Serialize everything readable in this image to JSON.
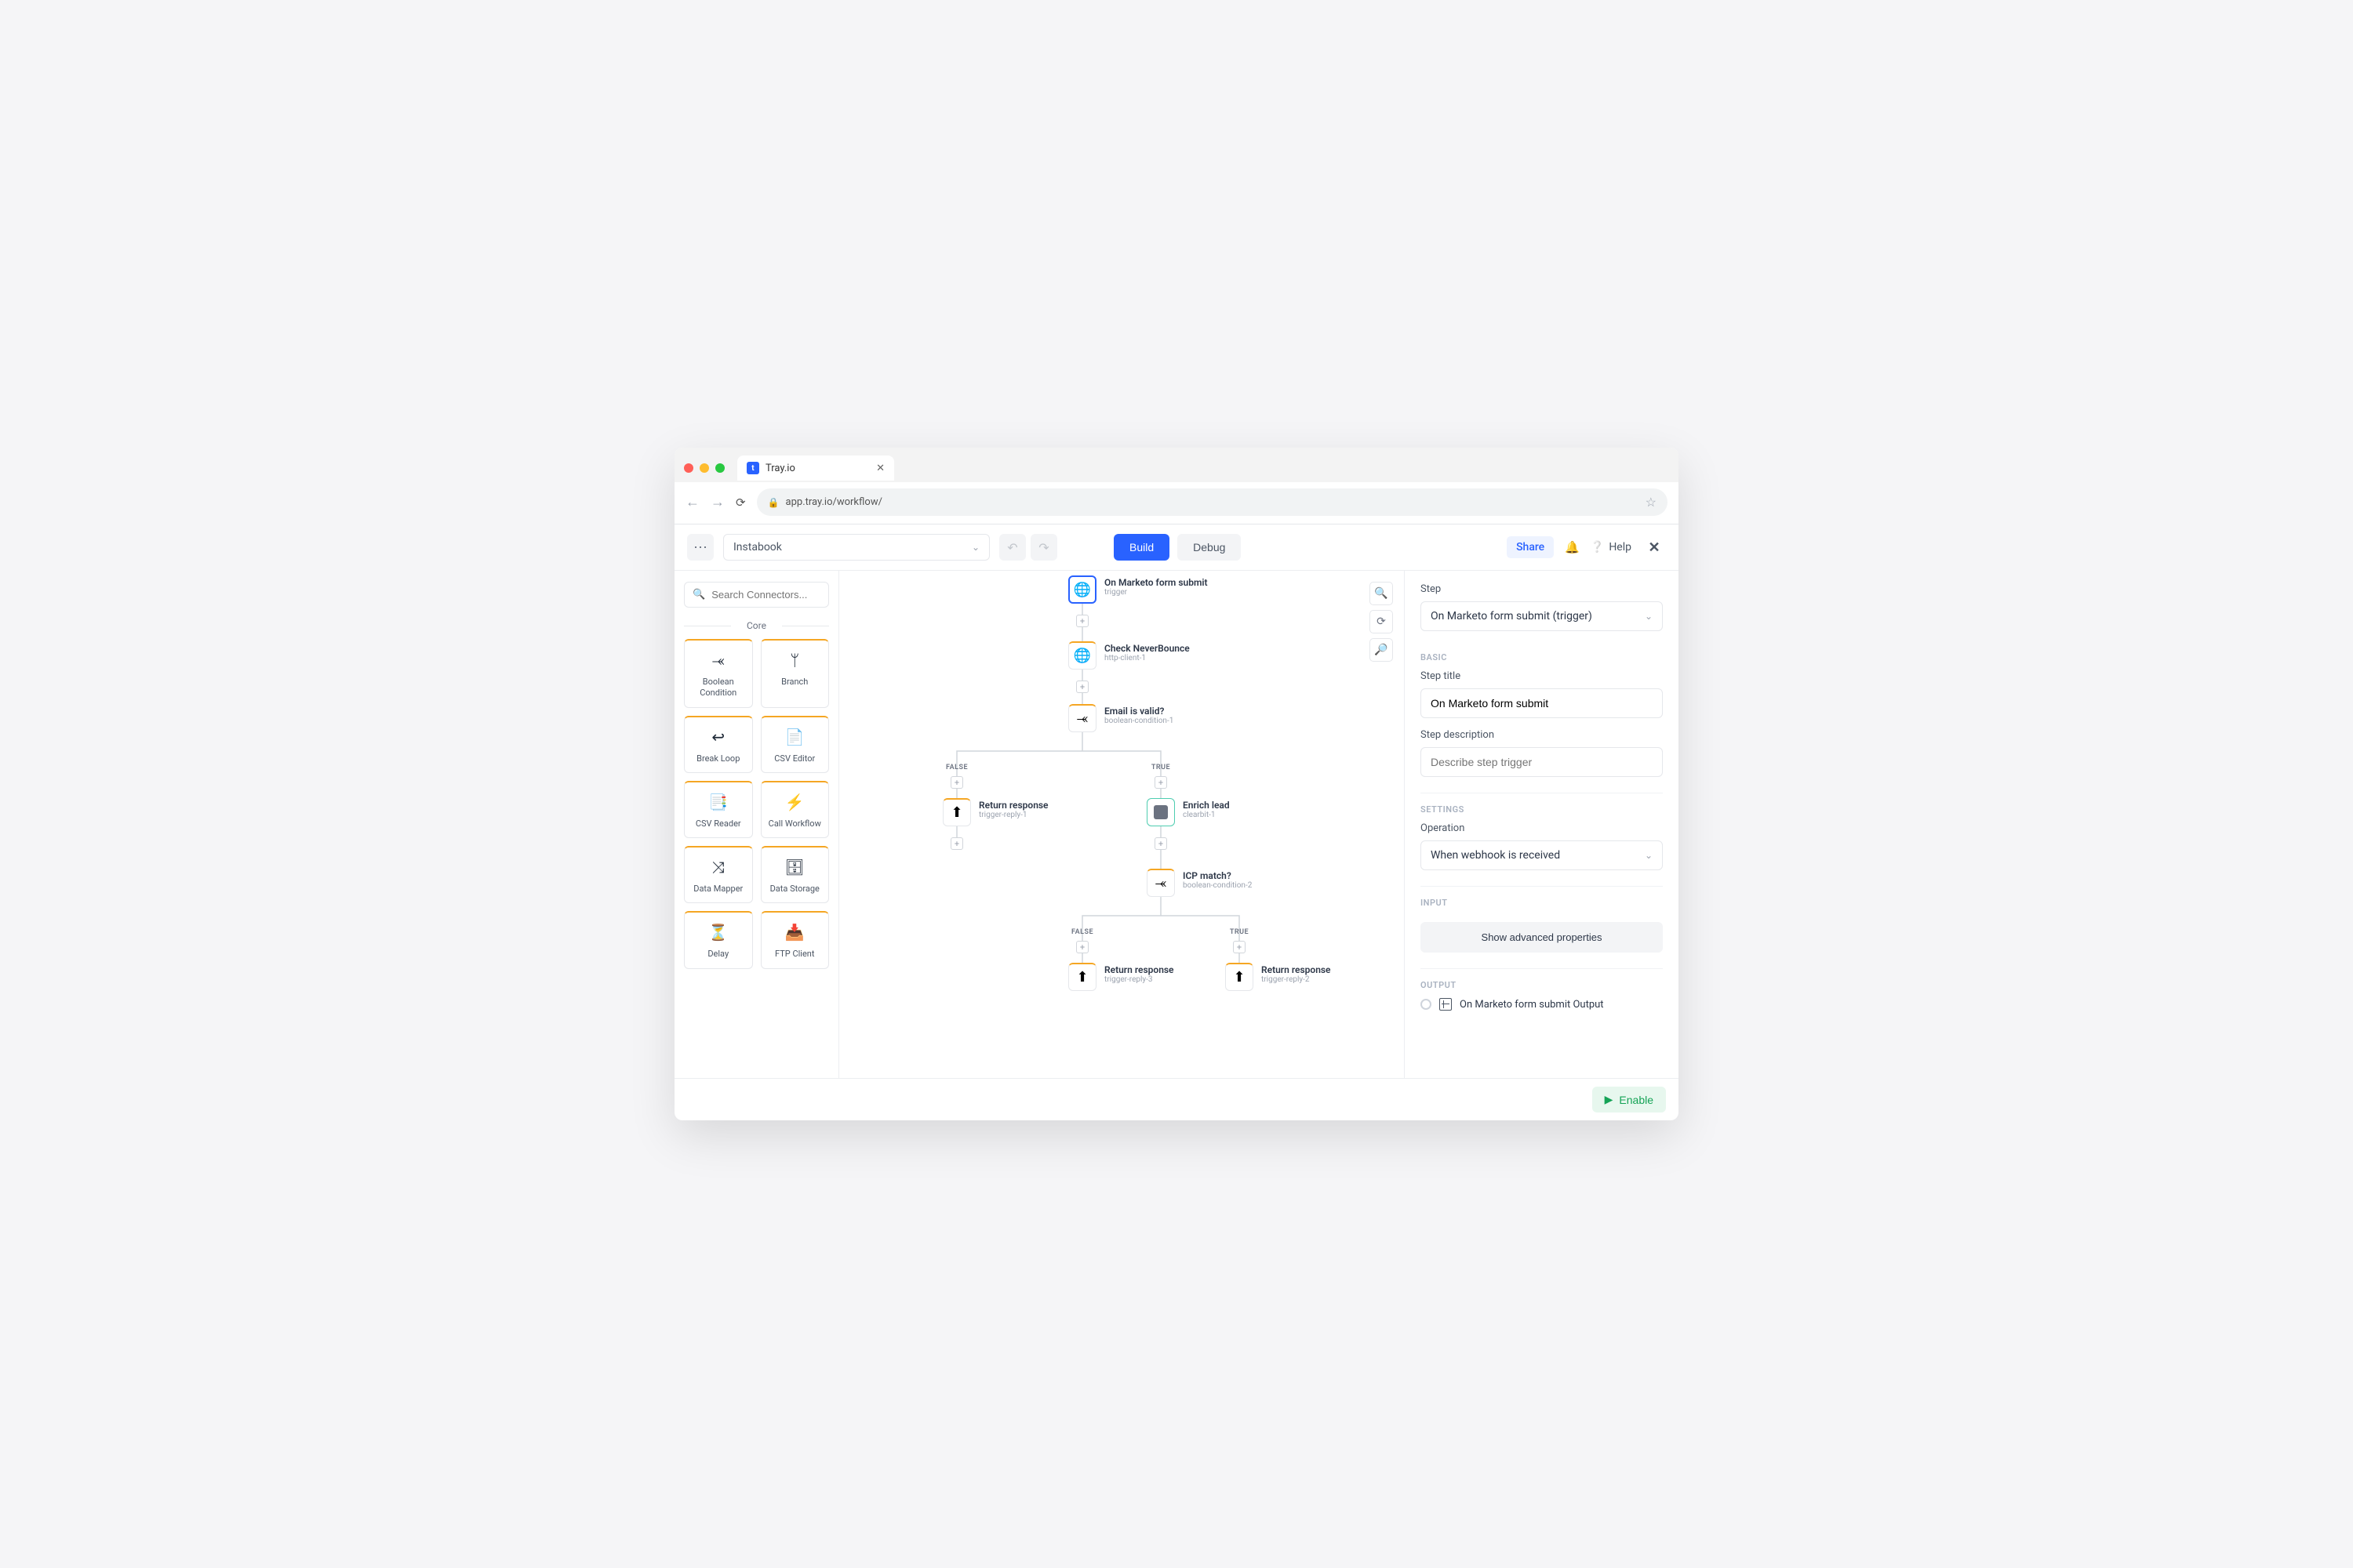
{
  "browser": {
    "tab_title": "Tray.io",
    "url": "app.tray.io/workflow/"
  },
  "topbar": {
    "workflow_name": "Instabook",
    "build_label": "Build",
    "debug_label": "Debug",
    "share_label": "Share",
    "help_label": "Help"
  },
  "sidebar": {
    "search_placeholder": "Search Connectors...",
    "section_label": "Core",
    "connectors": [
      {
        "label": "Boolean Condition",
        "icon": "boolean"
      },
      {
        "label": "Branch",
        "icon": "branch"
      },
      {
        "label": "Break Loop",
        "icon": "loop"
      },
      {
        "label": "CSV Editor",
        "icon": "csv-edit"
      },
      {
        "label": "CSV Reader",
        "icon": "csv-read"
      },
      {
        "label": "Call Workflow",
        "icon": "bolt"
      },
      {
        "label": "Data Mapper",
        "icon": "mapper"
      },
      {
        "label": "Data Storage",
        "icon": "storage"
      },
      {
        "label": "Delay",
        "icon": "delay"
      },
      {
        "label": "FTP Client",
        "icon": "ftp"
      }
    ]
  },
  "canvas": {
    "nodes": {
      "trigger": {
        "title": "On Marketo form submit",
        "sub": "trigger"
      },
      "check_nb": {
        "title": "Check NeverBounce",
        "sub": "http-client-1"
      },
      "email_valid": {
        "title": "Email is valid?",
        "sub": "boolean-condition-1"
      },
      "return_false": {
        "title": "Return response",
        "sub": "trigger-reply-1"
      },
      "enrich": {
        "title": "Enrich lead",
        "sub": "clearbit-1"
      },
      "icp": {
        "title": "ICP match?",
        "sub": "boolean-condition-2"
      },
      "return_icp_false": {
        "title": "Return response",
        "sub": "trigger-reply-3"
      },
      "return_icp_true": {
        "title": "Return response",
        "sub": "trigger-reply-2"
      }
    },
    "branch_labels": {
      "false": "FALSE",
      "true": "TRUE"
    }
  },
  "panel": {
    "step_label": "Step",
    "step_select": "On Marketo form submit (trigger)",
    "basic_header": "BASIC",
    "title_label": "Step title",
    "title_value": "On Marketo form submit",
    "desc_label": "Step description",
    "desc_placeholder": "Describe step trigger",
    "settings_header": "SETTINGS",
    "operation_label": "Operation",
    "operation_value": "When webhook is received",
    "input_header": "INPUT",
    "adv_label": "Show advanced properties",
    "output_header": "OUTPUT",
    "output_value": "On Marketo form submit Output"
  },
  "footer": {
    "enable_label": "Enable"
  }
}
